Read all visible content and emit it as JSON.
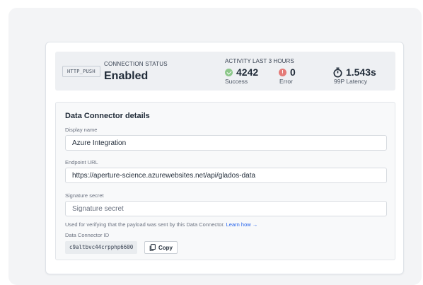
{
  "status": {
    "type_badge": "HTTP_PUSH",
    "connection_label": "CONNECTION STATUS",
    "connection_value": "Enabled",
    "activity_label": "ACTIVITY LAST 3 HOURS",
    "success": {
      "value": "4242",
      "label": "Success"
    },
    "error": {
      "value": "0",
      "label": "Error"
    },
    "latency": {
      "value": "1.543s",
      "label": "99P Latency"
    }
  },
  "details": {
    "title": "Data Connector details",
    "display_name": {
      "label": "Display name",
      "value": "Azure Integration"
    },
    "endpoint_url": {
      "label": "Endpoint URL",
      "value": "https://aperture-science.azurewebsites.net/api/glados-data"
    },
    "signature_secret": {
      "label": "Signature secret",
      "placeholder": "Signature secret",
      "value": ""
    },
    "help_text": "Used for verifying that the payload was sent by this Data Connector.",
    "help_link": "Learn how →",
    "connector_id_label": "Data Connector ID",
    "connector_id": "c9altbvc44crpphp6600",
    "copy_label": "Copy"
  },
  "colors": {
    "success": "#8cc78a",
    "error": "#e47b78",
    "link": "#2563eb"
  }
}
